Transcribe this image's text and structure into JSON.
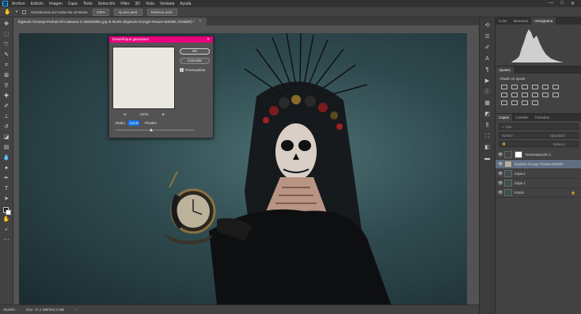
{
  "menubar": {
    "logo": "Ps",
    "items": [
      "Archivo",
      "Edición",
      "Imagen",
      "Capa",
      "Texto",
      "Selección",
      "Filtro",
      "3D",
      "Vista",
      "Ventana",
      "Ayuda"
    ],
    "window_controls": [
      "—",
      "□",
      "✕"
    ]
  },
  "options_bar": {
    "scroll_all_label": "Desplazarse por todas las ventanas",
    "zoom_value": "100%",
    "fit_screen_label": "Ajustar pant.",
    "fill_screen_label": "Rellenar pant."
  },
  "document_tabs": [
    {
      "label": "bigstock-Closeup-Portrait-Of-Calavera-C-260330881.jpg al 49,8% (bigstock-Grunge-Texture-606383, RGB/8#) *"
    }
  ],
  "tools": [
    "move-icon",
    "marquee-icon",
    "lasso-icon",
    "quick-select-icon",
    "crop-icon",
    "frame-icon",
    "eyedropper-icon",
    "healing-icon",
    "brush-icon",
    "stamp-icon",
    "history-brush-icon",
    "eraser-icon",
    "gradient-icon",
    "blur-icon",
    "dodge-icon",
    "pen-icon",
    "type-icon",
    "path-select-icon",
    "rectangle-icon",
    "hand-icon",
    "zoom-icon"
  ],
  "status_bar": {
    "zoom": "49,84%",
    "doc_info": "Doc: 17,1 MB/263,2 MB"
  },
  "dialog": {
    "title": "Desenfoque gaussiano",
    "ok_label": "OK",
    "cancel_label": "Cancelar",
    "preview_label": "Previsualizar",
    "preview_checked": true,
    "zoom_value": "100%",
    "radius_label": "Radio:",
    "radius_value": "112,9",
    "radius_unit": "Píxeles",
    "radius_slider_fraction": 0.45
  },
  "panels": {
    "histogram_tabs": [
      "Color",
      "Muestras",
      "Histograma"
    ],
    "histogram_active": "Histograma",
    "adjustments_tab": "Ajustes",
    "adjustments_subtitle": "Añadir un ajuste",
    "layers_tabs": [
      "Capas",
      "Canales",
      "Trazados"
    ],
    "layers_filter_placeholder": "Tipo",
    "blend_mode": "Normal",
    "opacity_label": "Opacidad:",
    "fill_label": "Relleno:",
    "layers": [
      {
        "name": "Tono/saturación 1",
        "selected": false
      },
      {
        "name": "bigstock-Grunge-Texture-606383",
        "selected": true
      },
      {
        "name": "Capa 2",
        "selected": false
      },
      {
        "name": "Capa 1",
        "selected": false
      },
      {
        "name": "Fondo",
        "selected": false
      }
    ]
  }
}
